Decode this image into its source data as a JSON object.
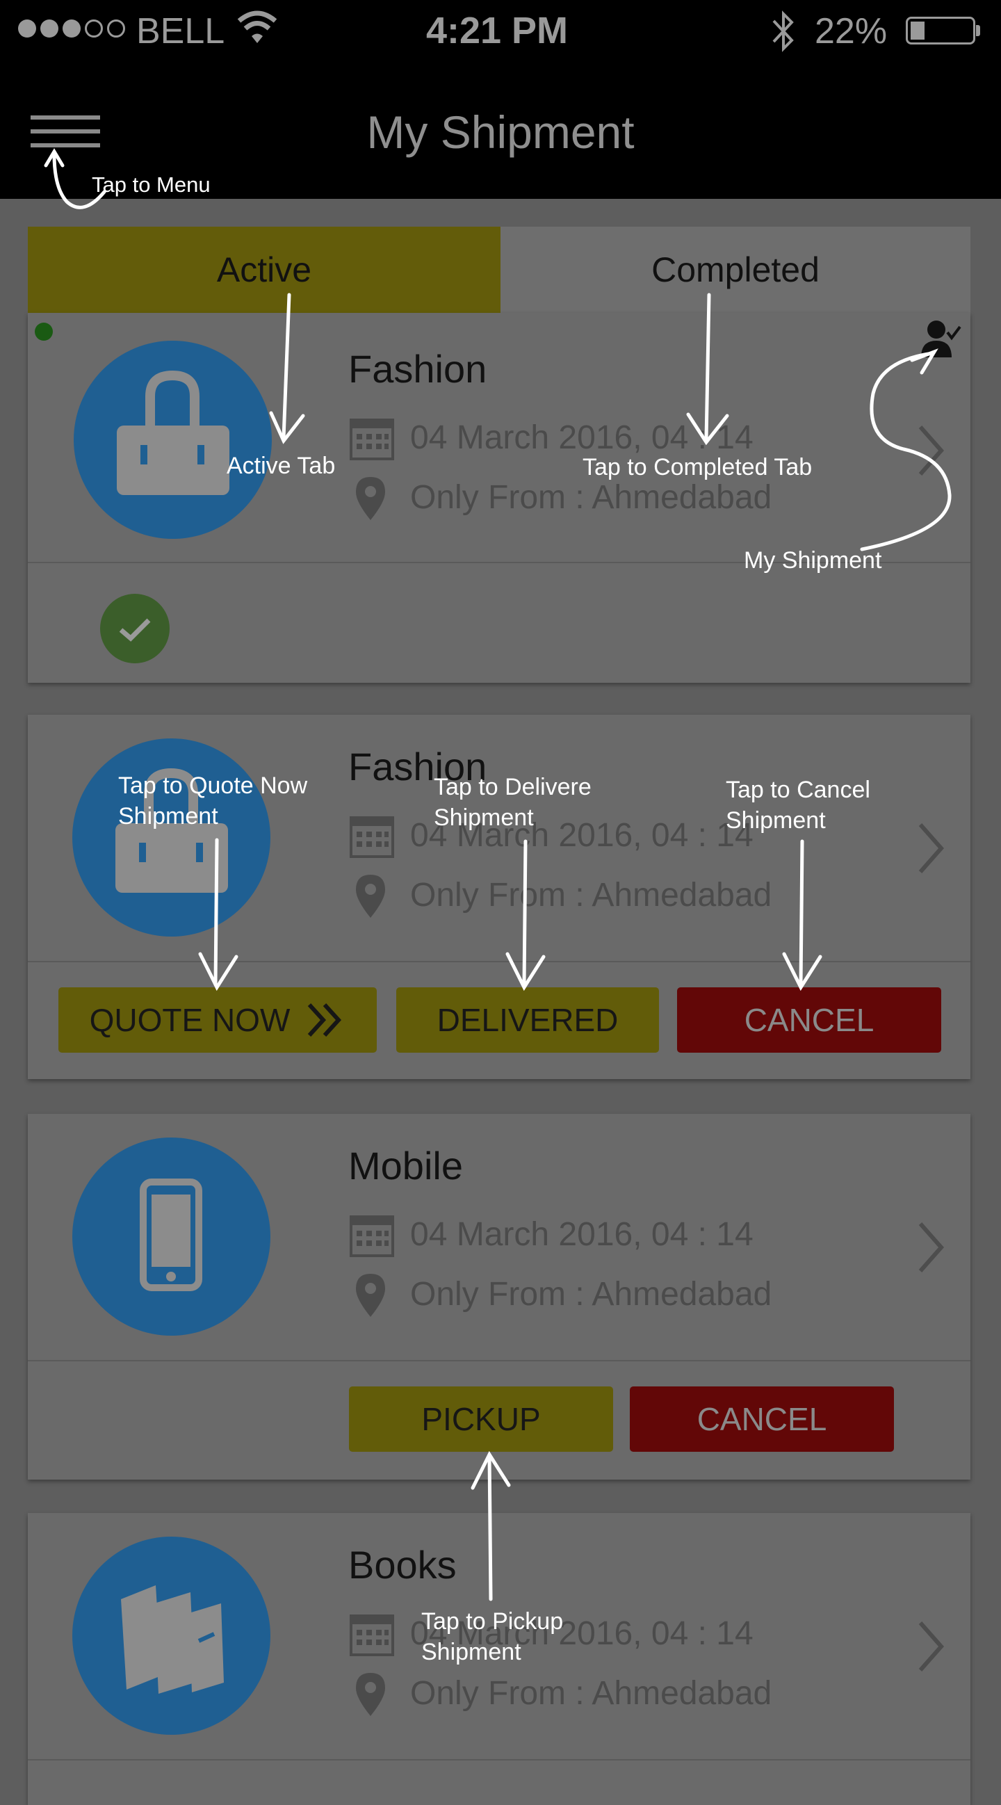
{
  "status_bar": {
    "carrier": "BELL",
    "time": "4:21 PM",
    "battery": "22%"
  },
  "header": {
    "title": "My Shipment"
  },
  "tabs": [
    {
      "label": "Active"
    },
    {
      "label": "Completed"
    }
  ],
  "cards": [
    {
      "title": "Fashion",
      "date": "04 March 2016, 04 : 14",
      "location": "Only From : Ahmedabad",
      "icon": "bag-icon"
    },
    {
      "title": "Fashion",
      "date": "04 March 2016, 04 : 14",
      "location": "Only From : Ahmedabad",
      "icon": "bag-icon",
      "buttons": {
        "quote": "QUOTE NOW",
        "delivered": "DELIVERED",
        "cancel": "CANCEL"
      }
    },
    {
      "title": "Mobile",
      "date": "04 March 2016, 04 : 14",
      "location": "Only From : Ahmedabad",
      "icon": "phone-icon",
      "buttons": {
        "pickup": "PICKUP",
        "cancel": "CANCEL"
      }
    },
    {
      "title": "Books",
      "date": "04 March 2016, 04 : 14",
      "location": "Only From : Ahmedabad",
      "icon": "books-icon"
    }
  ],
  "annotations": {
    "menu": "Tap to Menu",
    "active_tab": "Active Tab",
    "completed_tab": "Tap to Completed  Tab",
    "my_shipment": "My Shipment",
    "quote_now_1": "Tap to Quote Now",
    "quote_now_2": "Shipment",
    "delivered_1": "Tap to Delivere",
    "delivered_2": "Shipment",
    "cancel_1": "Tap to Cancel",
    "cancel_2": "Shipment",
    "pickup_1": "Tap to Pickup",
    "pickup_2": "Shipment"
  },
  "colors": {
    "accent_yellow": "#635c0a",
    "cancel_red": "#620707",
    "avatar_blue": "#1f5f92"
  }
}
